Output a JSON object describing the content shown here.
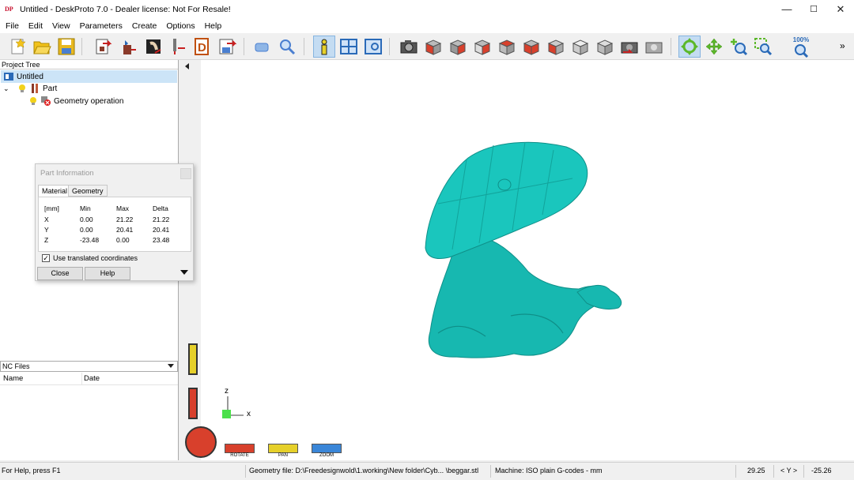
{
  "window": {
    "app_icon": "DP",
    "title": "Untitled - DeskProto 7.0 - Dealer license: Not For Resale!",
    "controls": [
      "—",
      "☐",
      "✕"
    ]
  },
  "menu": [
    "File",
    "Edit",
    "View",
    "Parameters",
    "Create",
    "Options",
    "Help"
  ],
  "toolbar": {
    "zoom_100_label": "100%",
    "overflow_label": "»"
  },
  "project_tree": {
    "header": "Project Tree",
    "root": "Untitled",
    "part": "Part",
    "operation": "Geometry operation"
  },
  "nc_files": {
    "header": "NC Files",
    "columns": [
      "Name",
      "Date"
    ]
  },
  "part_info": {
    "title": "Part Information",
    "tabs": [
      "Material",
      "Geometry"
    ],
    "headers": [
      "[mm]",
      "Min",
      "Max",
      "Delta"
    ],
    "rows": [
      [
        "X",
        "0.00",
        "21.22",
        "21.22"
      ],
      [
        "Y",
        "0.00",
        "20.41",
        "20.41"
      ],
      [
        "Z",
        "-23.48",
        "0.00",
        "23.48"
      ]
    ],
    "checkbox_label": "Use translated coordinates",
    "checkbox_checked": true,
    "close_label": "Close",
    "help_label": "Help"
  },
  "axes": {
    "z": "z",
    "x": "x"
  },
  "bottom_buttons": [
    "ROTATE",
    "PAN",
    "ZOOM"
  ],
  "status": {
    "help": "For Help, press F1",
    "geometry_file": "Geometry file: D:\\Freedesignwold\\1.working\\New folder\\Cyb... \\beggar.stl",
    "machine": "Machine: ISO plain G-codes - mm",
    "x_value": "29.25",
    "axis_label": "< Y >",
    "y_value": "-25.26"
  },
  "colors": {
    "model": "#17b8b0",
    "selection": "#cce4f7",
    "red_button": "#d8402c",
    "yellow_button": "#e6d02a",
    "blue_button": "#3a86d8"
  }
}
